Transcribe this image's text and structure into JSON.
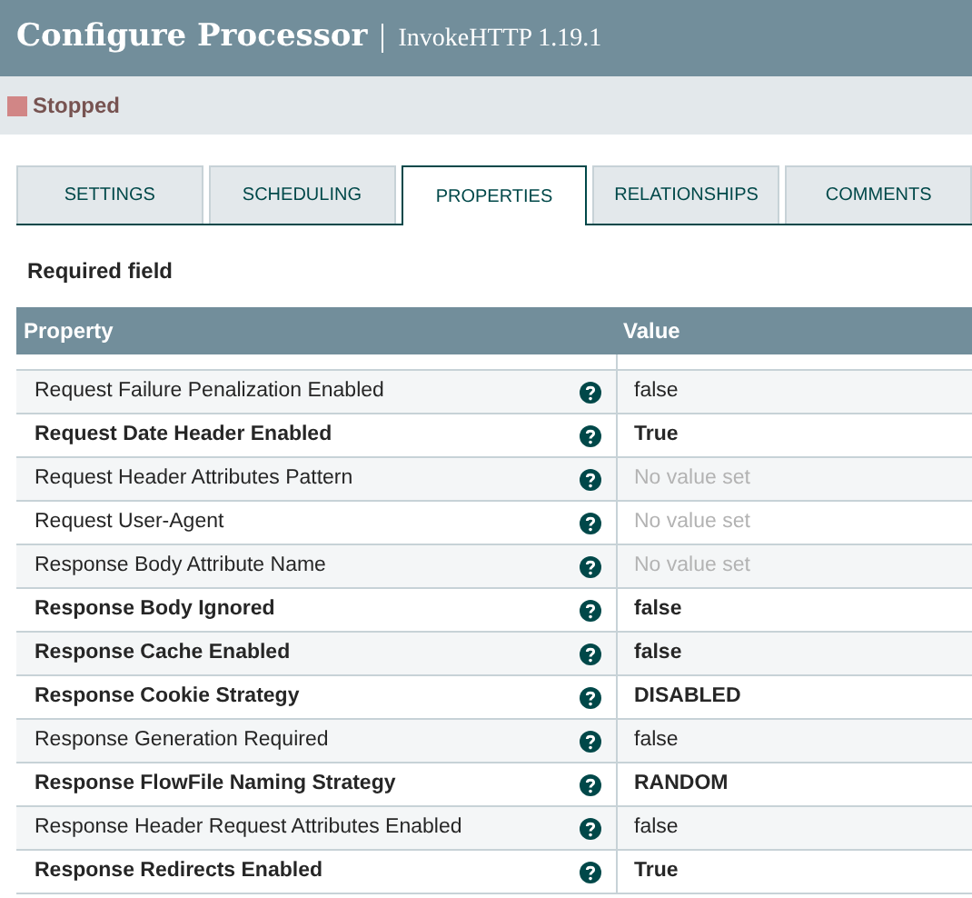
{
  "window": {
    "title": "Configure Processor",
    "subtitle": "InvokeHTTP 1.19.1"
  },
  "status": {
    "label": "Stopped",
    "color": "#d18686"
  },
  "tabs": [
    {
      "label": "SETTINGS",
      "selected": false
    },
    {
      "label": "SCHEDULING",
      "selected": false
    },
    {
      "label": "PROPERTIES",
      "selected": true
    },
    {
      "label": "RELATIONSHIPS",
      "selected": false
    },
    {
      "label": "COMMENTS",
      "selected": false
    }
  ],
  "required_note": "Required field",
  "table": {
    "columns": [
      "Property",
      "Value"
    ],
    "rows": [
      {
        "property": "Request Failure Penalization Enabled",
        "required": false,
        "value": "false",
        "value_set": true
      },
      {
        "property": "Request Date Header Enabled",
        "required": true,
        "value": "True",
        "value_set": true
      },
      {
        "property": "Request Header Attributes Pattern",
        "required": false,
        "value": "No value set",
        "value_set": false
      },
      {
        "property": "Request User-Agent",
        "required": false,
        "value": "No value set",
        "value_set": false
      },
      {
        "property": "Response Body Attribute Name",
        "required": false,
        "value": "No value set",
        "value_set": false
      },
      {
        "property": "Response Body Ignored",
        "required": true,
        "value": "false",
        "value_set": true
      },
      {
        "property": "Response Cache Enabled",
        "required": true,
        "value": "false",
        "value_set": true
      },
      {
        "property": "Response Cookie Strategy",
        "required": true,
        "value": "DISABLED",
        "value_set": true
      },
      {
        "property": "Response Generation Required",
        "required": false,
        "value": "false",
        "value_set": true
      },
      {
        "property": "Response FlowFile Naming Strategy",
        "required": true,
        "value": "RANDOM",
        "value_set": true
      },
      {
        "property": "Response Header Request Attributes Enabled",
        "required": false,
        "value": "false",
        "value_set": true
      },
      {
        "property": "Response Redirects Enabled",
        "required": true,
        "value": "True",
        "value_set": true
      }
    ]
  }
}
